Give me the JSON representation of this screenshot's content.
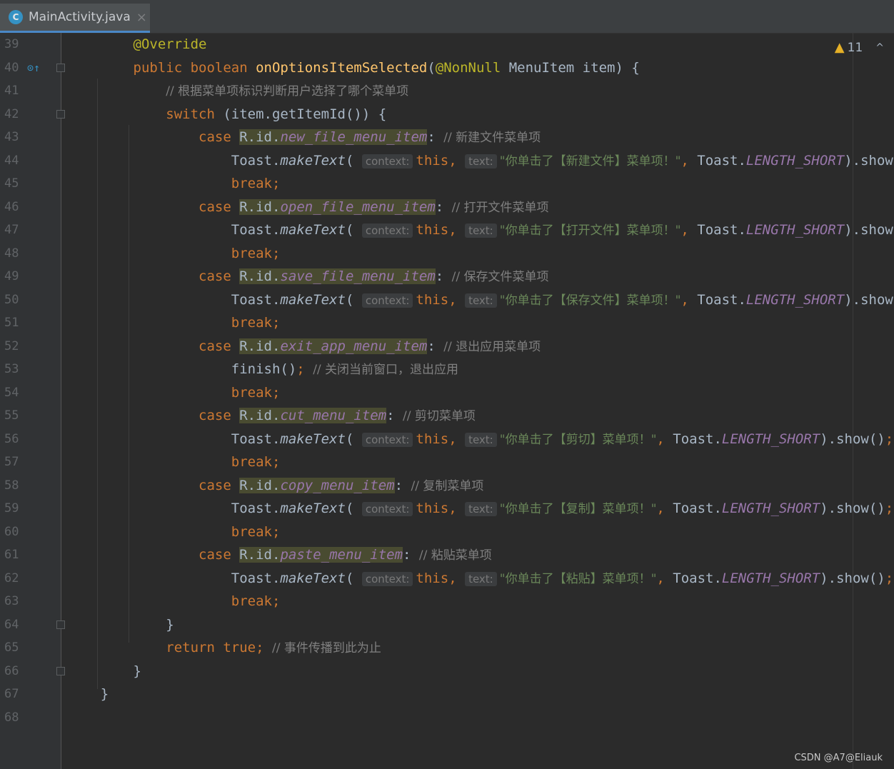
{
  "tab": {
    "icon_letter": "C",
    "file_name": "MainActivity.java",
    "close_glyph": "×"
  },
  "status": {
    "warning_count": "11",
    "warning_icon": "warning-triangle-icon",
    "collapse_glyph": "^"
  },
  "watermark": "CSDN @A7@Eliauk",
  "gutter": {
    "override_marker_icon": "override-up-arrow-icon"
  },
  "lines": [
    {
      "num": "39",
      "tokens": [
        {
          "t": "        "
        },
        {
          "t": "@Override",
          "c": "ann"
        }
      ]
    },
    {
      "num": "40",
      "tokens": [
        {
          "t": "        "
        },
        {
          "t": "public ",
          "c": "kw"
        },
        {
          "t": "boolean ",
          "c": "kw"
        },
        {
          "t": "onOptionsItemSelected",
          "c": "fn"
        },
        {
          "t": "("
        },
        {
          "t": "@NonNull",
          "c": "ann"
        },
        {
          "t": " MenuItem item) {"
        }
      ]
    },
    {
      "num": "41",
      "tokens": [
        {
          "t": "            "
        },
        {
          "t": "// 根据菜单项标识判断用户选择了哪个菜单项",
          "c": "cmt"
        }
      ]
    },
    {
      "num": "42",
      "tokens": [
        {
          "t": "            "
        },
        {
          "t": "switch ",
          "c": "kw"
        },
        {
          "t": "(item.getItemId()) {"
        }
      ]
    },
    {
      "num": "43",
      "tokens": [
        {
          "t": "                "
        },
        {
          "t": "case ",
          "c": "kw"
        },
        {
          "t": "R.id.",
          "c": "rhl"
        },
        {
          "t": "new_file_menu_item",
          "c": "field rhl"
        },
        {
          "t": ": "
        },
        {
          "t": "// 新建文件菜单项",
          "c": "cmt"
        }
      ]
    },
    {
      "num": "44",
      "tokens": [
        {
          "t": "                    Toast."
        },
        {
          "t": "makeText",
          "c": "static-m"
        },
        {
          "t": "( "
        },
        {
          "t": "context:",
          "c": "hint"
        },
        {
          "t": "this",
          "c": "kw"
        },
        {
          "t": ", ",
          "c": "kw"
        },
        {
          "t": "text:",
          "c": "hint"
        },
        {
          "t": "\"你单击了【新建文件】菜单项！\"",
          "c": "str-cn"
        },
        {
          "t": ", ",
          "c": "kw"
        },
        {
          "t": "Toast."
        },
        {
          "t": "LENGTH_SHORT",
          "c": "field"
        },
        {
          "t": ").show()"
        },
        {
          "t": ";",
          "c": "kw"
        }
      ]
    },
    {
      "num": "45",
      "tokens": [
        {
          "t": "                    "
        },
        {
          "t": "break;",
          "c": "kw"
        }
      ]
    },
    {
      "num": "46",
      "tokens": [
        {
          "t": "                "
        },
        {
          "t": "case ",
          "c": "kw"
        },
        {
          "t": "R.id.",
          "c": "rhl"
        },
        {
          "t": "open_file_menu_item",
          "c": "field rhl"
        },
        {
          "t": ": "
        },
        {
          "t": "// 打开文件菜单项",
          "c": "cmt"
        }
      ]
    },
    {
      "num": "47",
      "tokens": [
        {
          "t": "                    Toast."
        },
        {
          "t": "makeText",
          "c": "static-m"
        },
        {
          "t": "( "
        },
        {
          "t": "context:",
          "c": "hint"
        },
        {
          "t": "this",
          "c": "kw"
        },
        {
          "t": ", ",
          "c": "kw"
        },
        {
          "t": "text:",
          "c": "hint"
        },
        {
          "t": "\"你单击了【打开文件】菜单项！\"",
          "c": "str-cn"
        },
        {
          "t": ", ",
          "c": "kw"
        },
        {
          "t": "Toast."
        },
        {
          "t": "LENGTH_SHORT",
          "c": "field"
        },
        {
          "t": ").show()"
        },
        {
          "t": ";",
          "c": "kw"
        }
      ]
    },
    {
      "num": "48",
      "tokens": [
        {
          "t": "                    "
        },
        {
          "t": "break;",
          "c": "kw"
        }
      ]
    },
    {
      "num": "49",
      "tokens": [
        {
          "t": "                "
        },
        {
          "t": "case ",
          "c": "kw"
        },
        {
          "t": "R.id.",
          "c": "rhl"
        },
        {
          "t": "save_file_menu_item",
          "c": "field rhl"
        },
        {
          "t": ": "
        },
        {
          "t": "// 保存文件菜单项",
          "c": "cmt"
        }
      ]
    },
    {
      "num": "50",
      "tokens": [
        {
          "t": "                    Toast."
        },
        {
          "t": "makeText",
          "c": "static-m"
        },
        {
          "t": "( "
        },
        {
          "t": "context:",
          "c": "hint"
        },
        {
          "t": "this",
          "c": "kw"
        },
        {
          "t": ", ",
          "c": "kw"
        },
        {
          "t": "text:",
          "c": "hint"
        },
        {
          "t": "\"你单击了【保存文件】菜单项！\"",
          "c": "str-cn"
        },
        {
          "t": ", ",
          "c": "kw"
        },
        {
          "t": "Toast."
        },
        {
          "t": "LENGTH_SHORT",
          "c": "field"
        },
        {
          "t": ").show()"
        },
        {
          "t": ";",
          "c": "kw"
        }
      ]
    },
    {
      "num": "51",
      "tokens": [
        {
          "t": "                    "
        },
        {
          "t": "break;",
          "c": "kw"
        }
      ]
    },
    {
      "num": "52",
      "tokens": [
        {
          "t": "                "
        },
        {
          "t": "case ",
          "c": "kw"
        },
        {
          "t": "R.id.",
          "c": "rhl"
        },
        {
          "t": "exit_app_menu_item",
          "c": "field rhl"
        },
        {
          "t": ": "
        },
        {
          "t": "// 退出应用菜单项",
          "c": "cmt"
        }
      ]
    },
    {
      "num": "53",
      "tokens": [
        {
          "t": "                    finish()"
        },
        {
          "t": "; ",
          "c": "kw"
        },
        {
          "t": "// 关闭当前窗口，退出应用",
          "c": "cmt"
        }
      ]
    },
    {
      "num": "54",
      "tokens": [
        {
          "t": "                    "
        },
        {
          "t": "break;",
          "c": "kw"
        }
      ]
    },
    {
      "num": "55",
      "tokens": [
        {
          "t": "                "
        },
        {
          "t": "case ",
          "c": "kw"
        },
        {
          "t": "R.id.",
          "c": "rhl"
        },
        {
          "t": "cut_menu_item",
          "c": "field rhl"
        },
        {
          "t": ": "
        },
        {
          "t": "// 剪切菜单项",
          "c": "cmt"
        }
      ]
    },
    {
      "num": "56",
      "tokens": [
        {
          "t": "                    Toast."
        },
        {
          "t": "makeText",
          "c": "static-m"
        },
        {
          "t": "( "
        },
        {
          "t": "context:",
          "c": "hint"
        },
        {
          "t": "this",
          "c": "kw"
        },
        {
          "t": ", ",
          "c": "kw"
        },
        {
          "t": "text:",
          "c": "hint"
        },
        {
          "t": "\"你单击了【剪切】菜单项！\"",
          "c": "str-cn"
        },
        {
          "t": ", ",
          "c": "kw"
        },
        {
          "t": "Toast."
        },
        {
          "t": "LENGTH_SHORT",
          "c": "field"
        },
        {
          "t": ").show()"
        },
        {
          "t": ";",
          "c": "kw"
        }
      ]
    },
    {
      "num": "57",
      "tokens": [
        {
          "t": "                    "
        },
        {
          "t": "break;",
          "c": "kw"
        }
      ]
    },
    {
      "num": "58",
      "tokens": [
        {
          "t": "                "
        },
        {
          "t": "case ",
          "c": "kw"
        },
        {
          "t": "R.id.",
          "c": "rhl"
        },
        {
          "t": "copy_menu_item",
          "c": "field rhl"
        },
        {
          "t": ": "
        },
        {
          "t": "// 复制菜单项",
          "c": "cmt"
        }
      ]
    },
    {
      "num": "59",
      "tokens": [
        {
          "t": "                    Toast."
        },
        {
          "t": "makeText",
          "c": "static-m"
        },
        {
          "t": "( "
        },
        {
          "t": "context:",
          "c": "hint"
        },
        {
          "t": "this",
          "c": "kw"
        },
        {
          "t": ", ",
          "c": "kw"
        },
        {
          "t": "text:",
          "c": "hint"
        },
        {
          "t": "\"你单击了【复制】菜单项！\"",
          "c": "str-cn"
        },
        {
          "t": ", ",
          "c": "kw"
        },
        {
          "t": "Toast."
        },
        {
          "t": "LENGTH_SHORT",
          "c": "field"
        },
        {
          "t": ").show()"
        },
        {
          "t": ";",
          "c": "kw"
        }
      ]
    },
    {
      "num": "60",
      "tokens": [
        {
          "t": "                    "
        },
        {
          "t": "break;",
          "c": "kw"
        }
      ]
    },
    {
      "num": "61",
      "tokens": [
        {
          "t": "                "
        },
        {
          "t": "case ",
          "c": "kw"
        },
        {
          "t": "R.id.",
          "c": "rhl"
        },
        {
          "t": "paste_menu_item",
          "c": "field rhl"
        },
        {
          "t": ": "
        },
        {
          "t": "// 粘贴菜单项",
          "c": "cmt"
        }
      ]
    },
    {
      "num": "62",
      "tokens": [
        {
          "t": "                    Toast."
        },
        {
          "t": "makeText",
          "c": "static-m"
        },
        {
          "t": "( "
        },
        {
          "t": "context:",
          "c": "hint"
        },
        {
          "t": "this",
          "c": "kw"
        },
        {
          "t": ", ",
          "c": "kw"
        },
        {
          "t": "text:",
          "c": "hint"
        },
        {
          "t": "\"你单击了【粘贴】菜单项！\"",
          "c": "str-cn"
        },
        {
          "t": ", ",
          "c": "kw"
        },
        {
          "t": "Toast."
        },
        {
          "t": "LENGTH_SHORT",
          "c": "field"
        },
        {
          "t": ").show()"
        },
        {
          "t": ";",
          "c": "kw"
        }
      ]
    },
    {
      "num": "63",
      "tokens": [
        {
          "t": "                    "
        },
        {
          "t": "break;",
          "c": "kw"
        }
      ]
    },
    {
      "num": "64",
      "tokens": [
        {
          "t": "            }"
        }
      ]
    },
    {
      "num": "65",
      "tokens": [
        {
          "t": "            "
        },
        {
          "t": "return ",
          "c": "kw"
        },
        {
          "t": "true",
          "c": "kw"
        },
        {
          "t": "; ",
          "c": "kw"
        },
        {
          "t": "// 事件传播到此为止",
          "c": "cmt"
        }
      ]
    },
    {
      "num": "66",
      "tokens": [
        {
          "t": "        }"
        }
      ]
    },
    {
      "num": "67",
      "tokens": [
        {
          "t": "    }"
        }
      ]
    },
    {
      "num": "68",
      "tokens": []
    }
  ]
}
